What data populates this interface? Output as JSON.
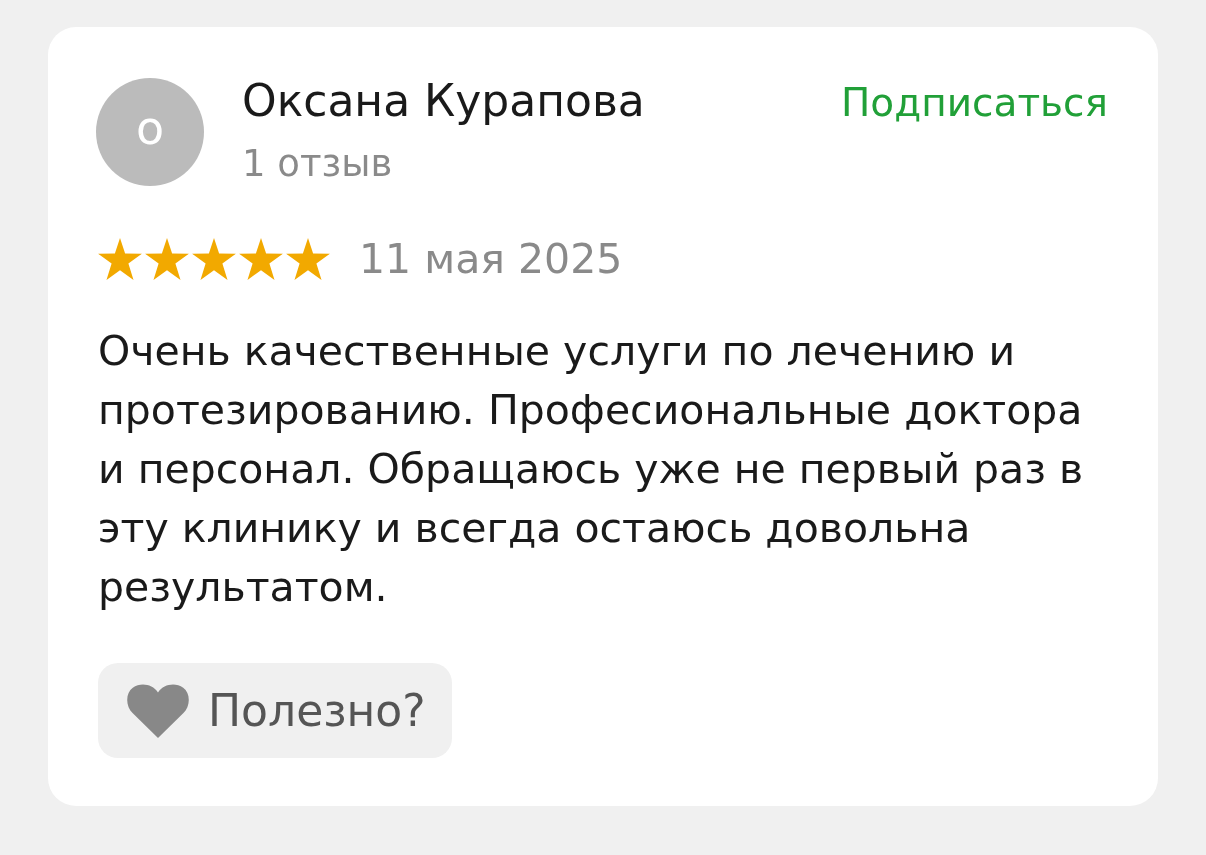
{
  "review": {
    "author": {
      "initial": "о",
      "name": "Оксана Курапова",
      "reviews_count": "1 отзыв"
    },
    "subscribe": "Подписаться",
    "stars": 5,
    "date": "11 мая 2025",
    "text": "Очень качественные услуги по лечению и протезированию. Професиональные доктора и персонал. Обращаюсь уже не первый раз в эту клинику и всегда остаюсь довольна результатом.",
    "helpful_button": "Полезно?"
  }
}
